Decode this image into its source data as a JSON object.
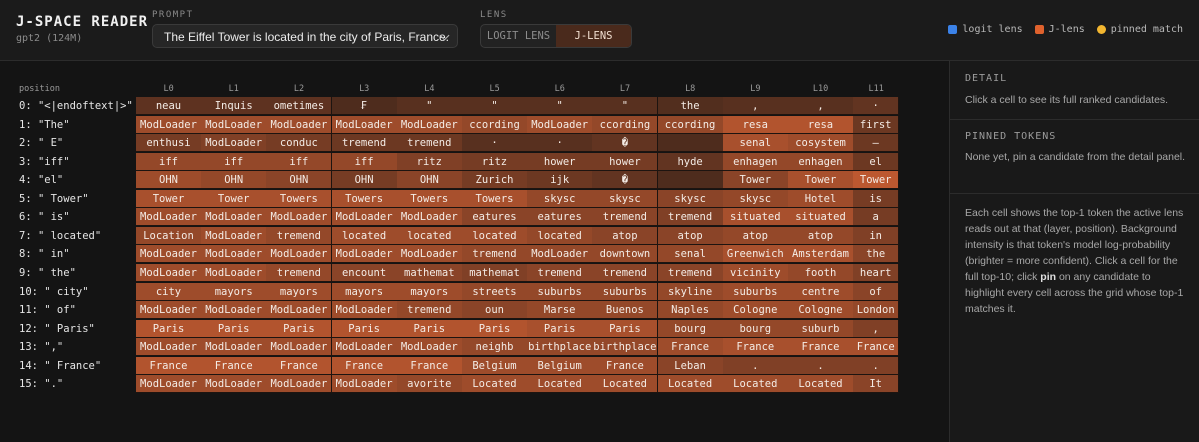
{
  "app": {
    "title": "J-SPACE READER",
    "model": "gpt2 (124M)"
  },
  "prompt": {
    "label": "PROMPT",
    "value": "The Eiffel Tower is located in the city of Paris, France."
  },
  "lens": {
    "label": "LENS",
    "options": [
      "LOGIT LENS",
      "J-LENS"
    ],
    "active": "J-LENS"
  },
  "legend": [
    {
      "label": "logit lens",
      "color": "#3b82e8",
      "shape": "square"
    },
    {
      "label": "J-lens",
      "color": "#e0622d",
      "shape": "square"
    },
    {
      "label": "pinned match",
      "color": "#f2b630",
      "shape": "circle"
    }
  ],
  "grid": {
    "position_header": "position",
    "layers": [
      "L0",
      "L1",
      "L2",
      "L3",
      "L4",
      "L5",
      "L6",
      "L7",
      "L8",
      "L9",
      "L10",
      "L11"
    ],
    "rows": [
      {
        "label": "0: \"<|endoftext|>\"",
        "tokens": [
          "neau",
          "Inquis",
          "ometimes",
          "₣",
          "\"",
          "\"",
          "\"",
          "\"",
          "the",
          ",",
          ",",
          "·"
        ],
        "conf": [
          0.18,
          0.18,
          0.18,
          0.1,
          0.15,
          0.15,
          0.15,
          0.15,
          0.12,
          0.15,
          0.15,
          0.2
        ]
      },
      {
        "label": "1: \"The\"",
        "tokens": [
          "ModLoader",
          "ModLoader",
          "ModLoader",
          "ModLoader",
          "ModLoader",
          "ccording",
          "ModLoader",
          "ccording",
          "ccording",
          "resa",
          "resa",
          "first"
        ],
        "conf": [
          0.5,
          0.5,
          0.5,
          0.5,
          0.5,
          0.45,
          0.5,
          0.45,
          0.45,
          0.6,
          0.6,
          0.25
        ]
      },
      {
        "label": "2: \" E\"",
        "tokens": [
          "enthusi",
          "ModLoader",
          "conduc",
          "tremend",
          "tremend",
          "·",
          "·",
          "�",
          "",
          "senal",
          "cosystem",
          "–"
        ],
        "conf": [
          0.3,
          0.35,
          0.3,
          0.25,
          0.25,
          0.15,
          0.15,
          0.2,
          0.1,
          0.55,
          0.5,
          0.25
        ]
      },
      {
        "label": "3: \"iff\"",
        "tokens": [
          "iff",
          "iff",
          "iff",
          "iff",
          "ritz",
          "ritz",
          "hower",
          "hower",
          "hyde",
          "enhagen",
          "enhagen",
          "el"
        ],
        "conf": [
          0.45,
          0.45,
          0.45,
          0.45,
          0.35,
          0.3,
          0.3,
          0.3,
          0.2,
          0.45,
          0.45,
          0.25
        ]
      },
      {
        "label": "4: \"el\"",
        "tokens": [
          "OHN",
          "OHN",
          "OHN",
          "OHN",
          "OHN",
          "Zurich",
          "ijk",
          "�",
          "",
          "Tower",
          "Tower",
          "Tower"
        ],
        "conf": [
          0.5,
          0.45,
          0.4,
          0.3,
          0.4,
          0.3,
          0.25,
          0.2,
          0.1,
          0.4,
          0.55,
          0.65
        ]
      },
      {
        "label": "5: \" Tower\"",
        "tokens": [
          "Tower",
          "Tower",
          "Towers",
          "Towers",
          "Towers",
          "Towers",
          "skysc",
          "skysc",
          "skysc",
          "skysc",
          "Hotel",
          "is"
        ],
        "conf": [
          0.55,
          0.55,
          0.55,
          0.55,
          0.55,
          0.55,
          0.45,
          0.45,
          0.4,
          0.45,
          0.5,
          0.3
        ]
      },
      {
        "label": "6: \" is\"",
        "tokens": [
          "ModLoader",
          "ModLoader",
          "ModLoader",
          "ModLoader",
          "ModLoader",
          "eatures",
          "eatures",
          "tremend",
          "tremend",
          "situated",
          "situated",
          "a"
        ],
        "conf": [
          0.5,
          0.5,
          0.5,
          0.5,
          0.5,
          0.4,
          0.4,
          0.4,
          0.35,
          0.55,
          0.55,
          0.3
        ]
      },
      {
        "label": "7: \" located\"",
        "tokens": [
          "Location",
          "ModLoader",
          "tremend",
          "located",
          "located",
          "located",
          "located",
          "atop",
          "atop",
          "atop",
          "atop",
          "in"
        ],
        "conf": [
          0.45,
          0.5,
          0.45,
          0.5,
          0.5,
          0.5,
          0.45,
          0.4,
          0.4,
          0.45,
          0.45,
          0.35
        ]
      },
      {
        "label": "8: \" in\"",
        "tokens": [
          "ModLoader",
          "ModLoader",
          "ModLoader",
          "ModLoader",
          "ModLoader",
          "tremend",
          "ModLoader",
          "downtown",
          "senal",
          "Greenwich",
          "Amsterdam",
          "the"
        ],
        "conf": [
          0.5,
          0.5,
          0.5,
          0.5,
          0.5,
          0.45,
          0.45,
          0.45,
          0.45,
          0.55,
          0.55,
          0.4
        ]
      },
      {
        "label": "9: \" the\"",
        "tokens": [
          "ModLoader",
          "ModLoader",
          "tremend",
          "encount",
          "mathemat",
          "mathemat",
          "tremend",
          "tremend",
          "tremend",
          "vicinity",
          "footh",
          "heart"
        ],
        "conf": [
          0.5,
          0.5,
          0.45,
          0.4,
          0.4,
          0.35,
          0.4,
          0.4,
          0.4,
          0.5,
          0.45,
          0.35
        ]
      },
      {
        "label": "10: \" city\"",
        "tokens": [
          "city",
          "mayors",
          "mayors",
          "mayors",
          "mayors",
          "streets",
          "suburbs",
          "suburbs",
          "skyline",
          "suburbs",
          "centre",
          "of"
        ],
        "conf": [
          0.5,
          0.5,
          0.5,
          0.5,
          0.5,
          0.45,
          0.45,
          0.45,
          0.45,
          0.5,
          0.5,
          0.4
        ]
      },
      {
        "label": "11: \" of\"",
        "tokens": [
          "ModLoader",
          "ModLoader",
          "ModLoader",
          "ModLoader",
          "tremend",
          "oun",
          "Marse",
          "Buenos",
          "Naples",
          "Cologne",
          "Cologne",
          "London"
        ],
        "conf": [
          0.5,
          0.5,
          0.5,
          0.5,
          0.45,
          0.4,
          0.45,
          0.45,
          0.45,
          0.5,
          0.5,
          0.45
        ]
      },
      {
        "label": "12: \" Paris\"",
        "tokens": [
          "Paris",
          "Paris",
          "Paris",
          "Paris",
          "Paris",
          "Paris",
          "Paris",
          "Paris",
          "bourg",
          "bourg",
          "suburb",
          ","
        ],
        "conf": [
          0.6,
          0.6,
          0.6,
          0.6,
          0.6,
          0.6,
          0.55,
          0.55,
          0.45,
          0.45,
          0.45,
          0.35
        ]
      },
      {
        "label": "13: \",\"",
        "tokens": [
          "ModLoader",
          "ModLoader",
          "ModLoader",
          "ModLoader",
          "ModLoader",
          "neighb",
          "birthplace",
          "birthplace",
          "France",
          "France",
          "France",
          "France"
        ],
        "conf": [
          0.5,
          0.5,
          0.5,
          0.5,
          0.5,
          0.45,
          0.45,
          0.45,
          0.5,
          0.55,
          0.55,
          0.55
        ]
      },
      {
        "label": "14: \" France\"",
        "tokens": [
          "France",
          "France",
          "France",
          "France",
          "France",
          "Belgium",
          "Belgium",
          "France",
          "Leban",
          ".",
          ".",
          "."
        ],
        "conf": [
          0.6,
          0.6,
          0.6,
          0.6,
          0.6,
          0.5,
          0.5,
          0.5,
          0.4,
          0.35,
          0.35,
          0.35
        ]
      },
      {
        "label": "15: \".\"",
        "tokens": [
          "ModLoader",
          "ModLoader",
          "ModLoader",
          "ModLoader",
          "avorite",
          "Located",
          "Located",
          "Located",
          "Located",
          "Located",
          "Located",
          "It"
        ],
        "conf": [
          0.5,
          0.5,
          0.5,
          0.5,
          0.45,
          0.5,
          0.5,
          0.5,
          0.5,
          0.5,
          0.5,
          0.4
        ]
      }
    ]
  },
  "detail": {
    "title": "DETAIL",
    "text": "Click a cell to see its full ranked candidates."
  },
  "pinned": {
    "title": "PINNED TOKENS",
    "text": "None yet, pin a candidate from the detail panel."
  },
  "help": {
    "text_before": "Each cell shows the top-1 token the active lens reads out at that (layer, position). Background intensity is that token's model log-probability (brighter = more confident). Click a cell for the full top-10; click ",
    "bold": "pin",
    "text_after": " on any candidate to highlight every cell across the grid whose top-1 matches it."
  }
}
